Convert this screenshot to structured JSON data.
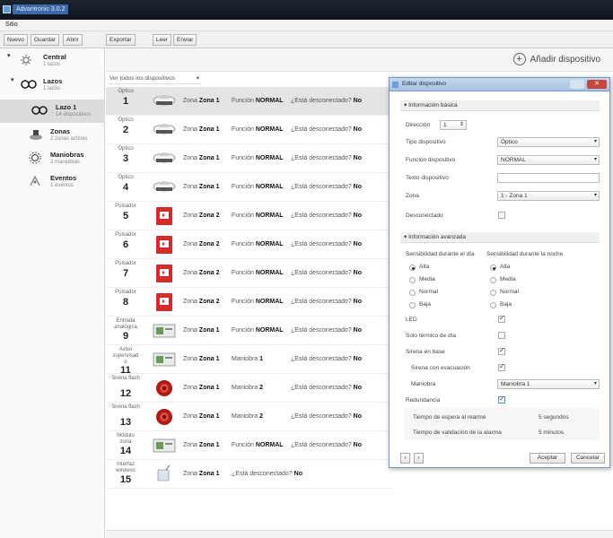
{
  "window": {
    "title": "Advantronic 3.0.2"
  },
  "menu": {
    "label": "Sitio"
  },
  "toolbar": {
    "new": "Nuevo",
    "save": "Guardar",
    "open": "Abrir",
    "export": "Exportar",
    "read": "Leer",
    "send": "Enviar"
  },
  "sidebar": {
    "items": [
      {
        "name": "Central",
        "sub": "1 lazos"
      },
      {
        "name": "Lazos",
        "sub": "1 lazos"
      },
      {
        "name": "Lazo 1",
        "sub": "14 dispositivos"
      },
      {
        "name": "Zonas",
        "sub": "2 zonas activas"
      },
      {
        "name": "Maniobras",
        "sub": "2 maniobras"
      },
      {
        "name": "Eventos",
        "sub": "1 eventos"
      }
    ]
  },
  "content": {
    "add_device": "Añadir dispositivo",
    "filter": "Ver todos los dispositivos",
    "rows": [
      {
        "type": "Óptico",
        "num": "1",
        "zone_label": "Zona",
        "zone": "Zona 1",
        "mode": "Función",
        "mode_val": "NORMAL",
        "q": "¿Está desconectado?",
        "a": "No"
      },
      {
        "type": "Óptico",
        "num": "2",
        "zone_label": "Zona",
        "zone": "Zona 1",
        "mode": "Función",
        "mode_val": "NORMAL",
        "q": "¿Está desconectado?",
        "a": "No"
      },
      {
        "type": "Óptico",
        "num": "3",
        "zone_label": "Zona",
        "zone": "Zona 1",
        "mode": "Función",
        "mode_val": "NORMAL",
        "q": "¿Está desconectado?",
        "a": "No"
      },
      {
        "type": "Óptico",
        "num": "4",
        "zone_label": "Zona",
        "zone": "Zona 1",
        "mode": "Función",
        "mode_val": "NORMAL",
        "q": "¿Está desconectado?",
        "a": "No"
      },
      {
        "type": "Pulsador",
        "num": "5",
        "zone_label": "Zona",
        "zone": "Zona 2",
        "mode": "Función",
        "mode_val": "NORMAL",
        "q": "¿Está desconectado?",
        "a": "No"
      },
      {
        "type": "Pulsador",
        "num": "6",
        "zone_label": "Zona",
        "zone": "Zona 2",
        "mode": "Función",
        "mode_val": "NORMAL",
        "q": "¿Está desconectado?",
        "a": "No"
      },
      {
        "type": "Pulsador",
        "num": "7",
        "zone_label": "Zona",
        "zone": "Zona 2",
        "mode": "Función",
        "mode_val": "NORMAL",
        "q": "¿Está desconectado?",
        "a": "No"
      },
      {
        "type": "Pulsador",
        "num": "8",
        "zone_label": "Zona",
        "zone": "Zona 2",
        "mode": "Función",
        "mode_val": "NORMAL",
        "q": "¿Está desconectado?",
        "a": "No"
      },
      {
        "type": "Entrada analógica",
        "num": "9",
        "zone_label": "Zona",
        "zone": "Zona 1",
        "mode": "Función",
        "mode_val": "NORMAL",
        "q": "¿Está desconectado?",
        "a": "No"
      },
      {
        "type": "Aviso supervisad o",
        "num": "11",
        "zone_label": "Zona",
        "zone": "Zona 1",
        "mode": "Maniobra",
        "mode_val": "1",
        "q": "¿Está desconectado?",
        "a": "No"
      },
      {
        "type": "Sirena flash",
        "num": "12",
        "zone_label": "Zona",
        "zone": "Zona 1",
        "mode": "Maniobra",
        "mode_val": "2",
        "q": "¿Está desconectado?",
        "a": "No"
      },
      {
        "type": "Sirena flash",
        "num": "13",
        "zone_label": "Zona",
        "zone": "Zona 1",
        "mode": "Maniobra",
        "mode_val": "2",
        "q": "¿Está desconectado?",
        "a": "No"
      },
      {
        "type": "Módulo zona",
        "num": "14",
        "zone_label": "Zona",
        "zone": "Zona 1",
        "mode": "Función",
        "mode_val": "NORMAL",
        "q": "¿Está desconectado?",
        "a": "No"
      },
      {
        "type": "Interfaz wireless",
        "num": "15",
        "zone_label": "Zona",
        "zone": "Zona 1",
        "mode": "",
        "mode_val": "",
        "q": "¿Está desconectado?",
        "a": "No"
      }
    ]
  },
  "dialog": {
    "title": "Editar dispositivo",
    "close": "✕",
    "basic": {
      "header": "Información básica",
      "address_label": "Dirección",
      "address_value": "1",
      "device_type_label": "Tipo dispositivo",
      "device_type_value": "Óptico",
      "device_function_label": "Función dispositivo",
      "device_function_value": "NORMAL",
      "device_text_label": "Texto dispositivo",
      "device_text_value": "",
      "zone_label": "Zona",
      "zone_value": "1 - Zona 1",
      "disconnected_label": "Desconectado"
    },
    "advanced": {
      "header": "Información avanzada",
      "day_label": "Sensibilidad durante el día",
      "night_label": "Sensibilidad durante la noche",
      "levels": [
        "Alta",
        "Media",
        "Normal",
        "Baja"
      ],
      "day_selected": "Alta",
      "night_selected": "Alta",
      "led_label": "LED",
      "thermal_label": "Solo térmico de día",
      "base_siren_label": "Sirena en base",
      "evac_siren_label": "Sirena con evacuación",
      "maneuver_label": "Maniobra",
      "maneuver_value": "Maniobra 1",
      "redundancy_label": "Redundancia",
      "wait_label": "Tiempo de espera al rearme",
      "wait_value": "5 segundos",
      "validation_label": "Tiempo de validación de la alarma",
      "validation_value": "5 minutos"
    },
    "accept": "Aceptar",
    "cancel": "Cancelar"
  }
}
